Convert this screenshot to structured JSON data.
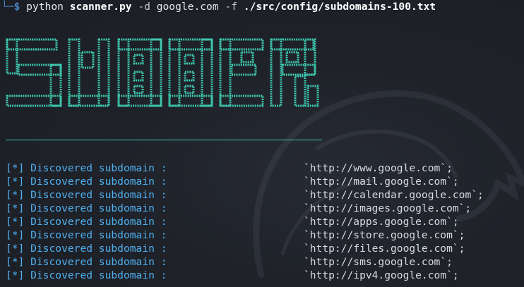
{
  "prompt": {
    "corner": "└─",
    "symbol": "$",
    "program": "python",
    "script": "scanner.py",
    "domain_flag": "-d",
    "domain": "google.com",
    "file_flag": "-f",
    "wordlist": "./src/config/subdomains-100.txt"
  },
  "banner": {
    "text": "SUBBR",
    "color": "#3ec9b0"
  },
  "results": [
    {
      "marker": "[*]",
      "message": "Discovered subdomain :",
      "url": "`http://www.google.com`;"
    },
    {
      "marker": "[*]",
      "message": "Discovered subdomain :",
      "url": "`http://mail.google.com`;"
    },
    {
      "marker": "[*]",
      "message": "Discovered subdomain :",
      "url": "`http://calendar.google.com`;"
    },
    {
      "marker": "[*]",
      "message": "Discovered subdomain :",
      "url": "`http://images.google.com`;"
    },
    {
      "marker": "[*]",
      "message": "Discovered subdomain :",
      "url": "`http://apps.google.com`;"
    },
    {
      "marker": "[*]",
      "message": "Discovered subdomain :",
      "url": "`http://store.google.com`;"
    },
    {
      "marker": "[*]",
      "message": "Discovered subdomain :",
      "url": "`http://files.google.com`;"
    },
    {
      "marker": "[*]",
      "message": "Discovered subdomain :",
      "url": "`http://sms.google.com`;"
    },
    {
      "marker": "[*]",
      "message": "Discovered subdomain :",
      "url": "`http://ipv4.google.com`;"
    }
  ],
  "colors": {
    "background": "#1c1f26",
    "prompt": "#4e86c8",
    "info": "#4fb0f0",
    "banner": "#3ec9b0"
  },
  "icons": {
    "watermark": "kali-dragon-icon"
  }
}
